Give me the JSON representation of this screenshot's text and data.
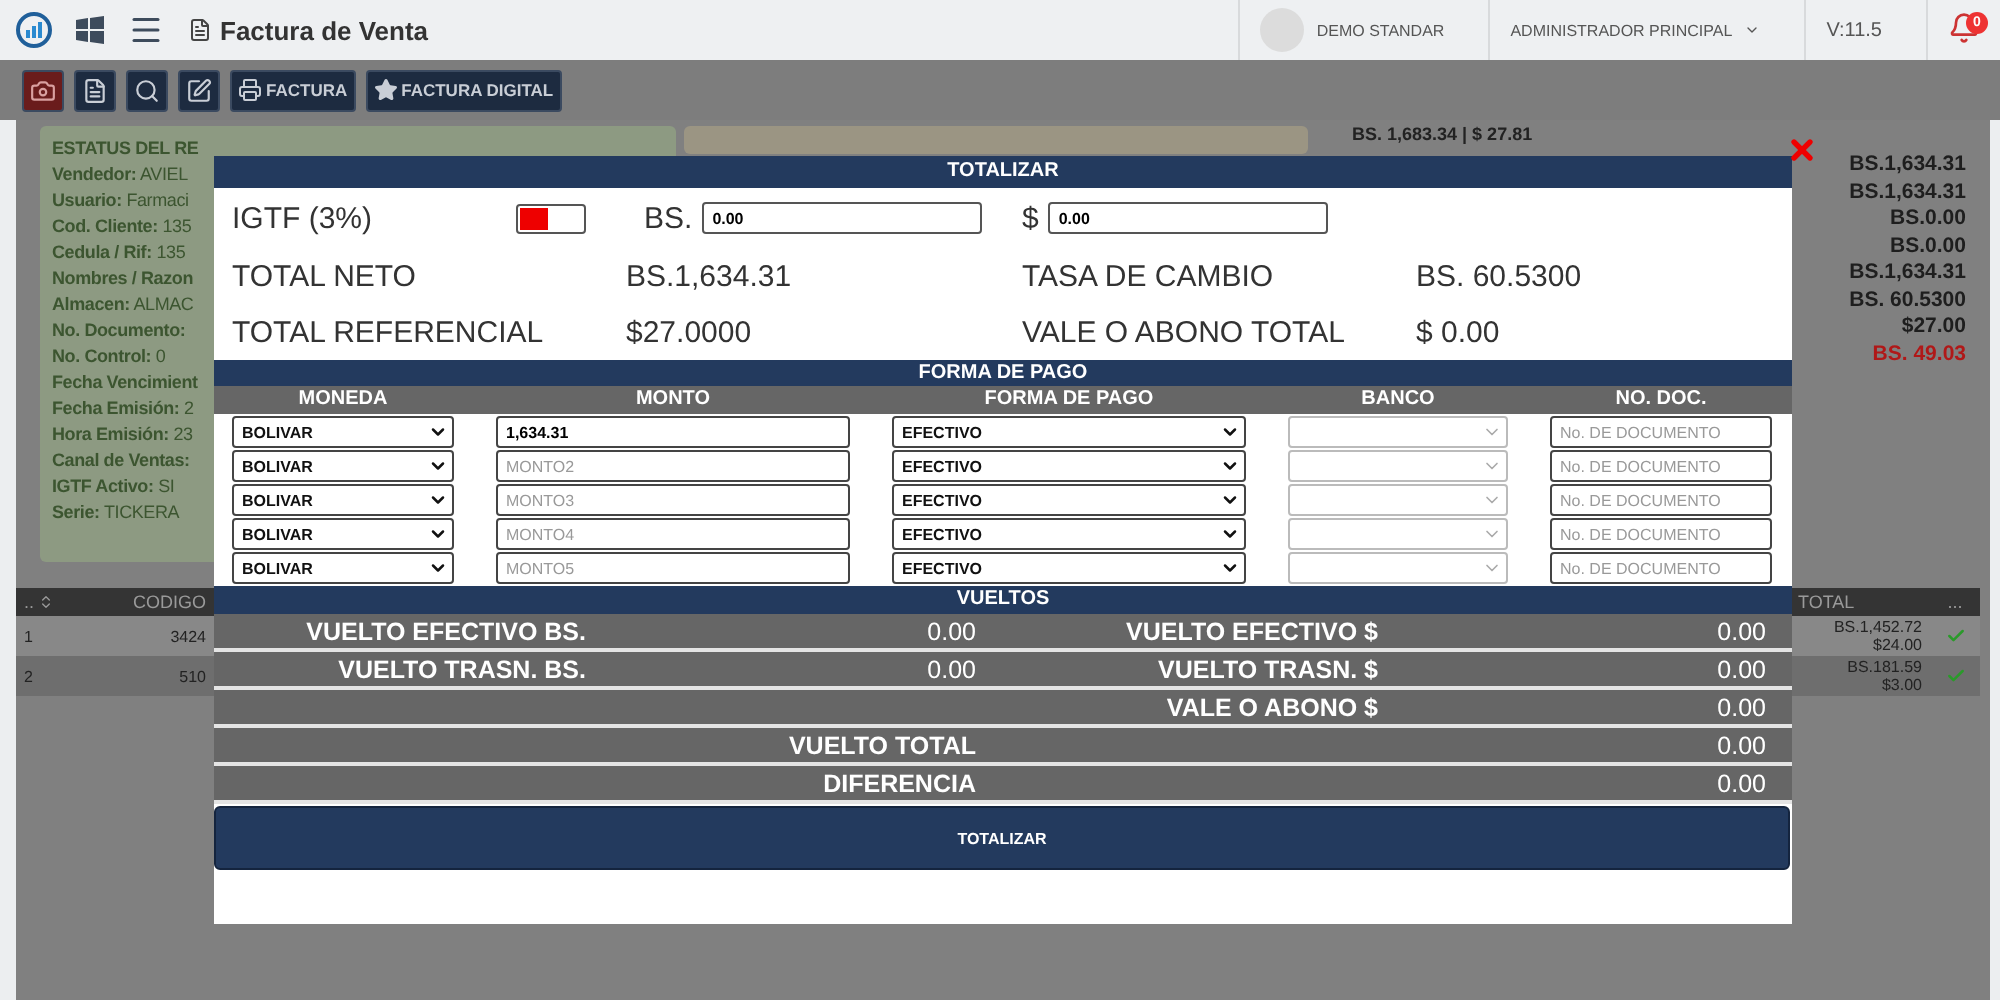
{
  "topbar": {
    "title": "Factura de Venta",
    "company": "DEMO STANDAR",
    "user": "ADMINISTRADOR PRINCIPAL",
    "version": "V:11.5",
    "notifications": "0"
  },
  "toolbar": {
    "labeled_buttons": [
      "FACTURA",
      "FACTURA DIGITAL"
    ]
  },
  "record": {
    "title": "ESTATUS DEL RE",
    "fields": [
      {
        "label": "Vendedor:",
        "value": "AVIEL"
      },
      {
        "label": "Usuario:",
        "value": "Farmaci"
      },
      {
        "label": "Cod. Cliente:",
        "value": "135"
      },
      {
        "label": "Cedula / Rif:",
        "value": "135"
      },
      {
        "label": "Nombres / Razon"
      },
      {
        "label": "Almacen:",
        "value": "ALMAC"
      },
      {
        "label": "No. Documento:"
      },
      {
        "label": "No. Control:",
        "value": "0"
      },
      {
        "label": "Fecha Vencimient"
      },
      {
        "label": "Fecha Emisión:",
        "value": "2"
      },
      {
        "label": "Hora Emisión:",
        "value": "23"
      },
      {
        "label": "Canal de Ventas:"
      },
      {
        "label": "IGTF Activo:",
        "value": "SI"
      },
      {
        "label": "Serie:",
        "value": "TICKERA"
      }
    ]
  },
  "summary": "BS. 1,683.34 | $ 27.81",
  "totals_column": [
    {
      "value": "BS.1,634.31",
      "alert": false
    },
    {
      "value": "BS.1,634.31",
      "alert": false
    },
    {
      "value": "BS.0.00",
      "alert": false
    },
    {
      "value": "BS.0.00",
      "alert": false
    },
    {
      "value": "BS.1,634.31",
      "alert": false
    },
    {
      "value": "BS. 60.5300",
      "alert": false
    },
    {
      "value": "$27.00",
      "alert": false
    },
    {
      "value": "BS. 49.03",
      "alert": true
    }
  ],
  "table": {
    "columns": [
      "..",
      "CODIGO",
      "TOTAL",
      "..."
    ],
    "rows": [
      {
        "index": "1",
        "code": "3424",
        "total_bs": "BS.1,452.72",
        "total_usd": "$24.00",
        "ok": true
      },
      {
        "index": "2",
        "code": "510",
        "total_bs": "BS.181.59",
        "total_usd": "$3.00",
        "ok": true
      }
    ]
  },
  "modal": {
    "title": "TOTALIZAR",
    "igtf": {
      "label": "IGTF (3%)",
      "on": false
    },
    "bs": {
      "label": "BS.",
      "value": "0.00"
    },
    "usd": {
      "label": "$",
      "value": "0.00"
    },
    "figures": [
      {
        "label": "TOTAL NETO",
        "value": "BS.1,634.31"
      },
      {
        "label": "TASA DE CAMBIO",
        "value": "BS. 60.5300"
      },
      {
        "label": "TOTAL REFERENCIAL",
        "value": "$27.0000"
      },
      {
        "label": "VALE O ABONO TOTAL",
        "value": "$ 0.00"
      }
    ],
    "payment": {
      "title": "FORMA DE PAGO",
      "columns": [
        "MONEDA",
        "MONTO",
        "FORMA DE PAGO",
        "BANCO",
        "NO. DOC."
      ],
      "rows": [
        {
          "currency": "BOLIVAR",
          "amount": "1,634.31",
          "method": "EFECTIVO",
          "bank_disabled": true,
          "doc_placeholder": "No. DE DOCUMENTO"
        },
        {
          "currency": "BOLIVAR",
          "amount_placeholder": "MONTO2",
          "method": "EFECTIVO",
          "bank_disabled": true,
          "doc_placeholder": "No. DE DOCUMENTO"
        },
        {
          "currency": "BOLIVAR",
          "amount_placeholder": "MONTO3",
          "method": "EFECTIVO",
          "bank_disabled": true,
          "doc_placeholder": "No. DE DOCUMENTO"
        },
        {
          "currency": "BOLIVAR",
          "amount_placeholder": "MONTO4",
          "method": "EFECTIVO",
          "bank_disabled": true,
          "doc_placeholder": "No. DE DOCUMENTO"
        },
        {
          "currency": "BOLIVAR",
          "amount_placeholder": "MONTO5",
          "method": "EFECTIVO",
          "bank_disabled": true,
          "doc_placeholder": "No. DE DOCUMENTO"
        }
      ]
    },
    "change": {
      "title": "VUELTOS",
      "rows": [
        {
          "kind": "pair",
          "left_label": "VUELTO EFECTIVO BS.",
          "left_value": "0.00",
          "right_label": "VUELTO EFECTIVO $",
          "right_value": "0.00"
        },
        {
          "kind": "pair",
          "left_label": "VUELTO TRASN. BS.",
          "left_value": "0.00",
          "right_label": "VUELTO TRASN. $",
          "right_value": "0.00"
        },
        {
          "kind": "pair",
          "right_label": "VALE O ABONO $",
          "right_value": "0.00"
        },
        {
          "kind": "total",
          "label": "VUELTO TOTAL",
          "value": "0.00"
        },
        {
          "kind": "total",
          "label": "DIFERENCIA",
          "value": "0.00"
        }
      ]
    },
    "submit": "TOTALIZAR"
  }
}
